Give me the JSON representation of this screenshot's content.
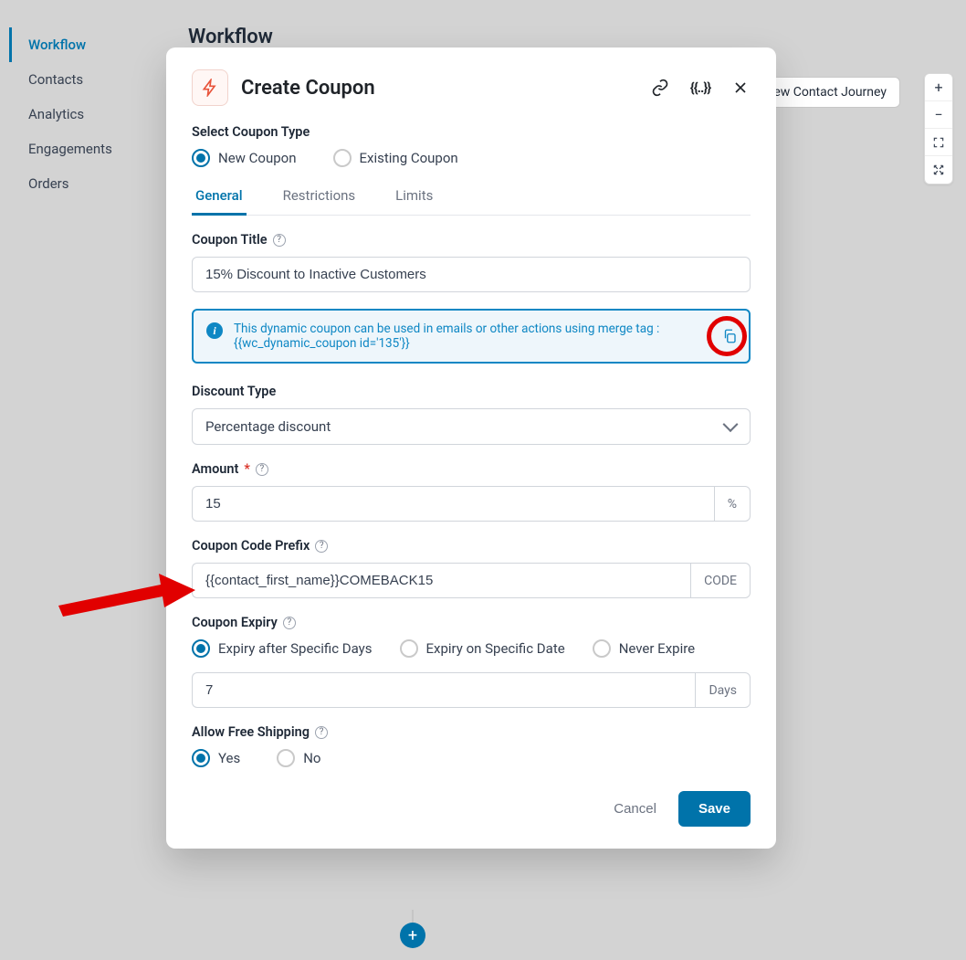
{
  "sidebar": {
    "items": [
      {
        "label": "Workflow",
        "active": true
      },
      {
        "label": "Contacts",
        "active": false
      },
      {
        "label": "Analytics",
        "active": false
      },
      {
        "label": "Engagements",
        "active": false
      },
      {
        "label": "Orders",
        "active": false
      }
    ]
  },
  "page": {
    "heading": "Workflow"
  },
  "peek_button": "ew Contact Journey",
  "zoom": {
    "plus": "+",
    "minus": "−"
  },
  "modal": {
    "title": "Create Coupon",
    "merge_icon": "{{..}}",
    "select_type_label": "Select Coupon Type",
    "type_options": {
      "new": "New Coupon",
      "existing": "Existing Coupon"
    },
    "tabs": {
      "general": "General",
      "restrictions": "Restrictions",
      "limits": "Limits"
    },
    "coupon_title_label": "Coupon Title",
    "coupon_title_value": "15% Discount to Inactive Customers",
    "info_banner": {
      "line1": "This dynamic coupon can be used in emails or other actions using merge tag :",
      "line2": "{{wc_dynamic_coupon id='135'}}"
    },
    "discount_type_label": "Discount Type",
    "discount_type_value": "Percentage discount",
    "amount_label": "Amount",
    "amount_value": "15",
    "amount_suffix": "%",
    "prefix_label": "Coupon Code Prefix",
    "prefix_value": "{{contact_first_name}}COMEBACK15",
    "prefix_suffix": "CODE",
    "expiry_label": "Coupon Expiry",
    "expiry_options": {
      "days": "Expiry after Specific Days",
      "date": "Expiry on Specific Date",
      "never": "Never Expire"
    },
    "expiry_value": "7",
    "expiry_suffix": "Days",
    "free_ship_label": "Allow Free Shipping",
    "yes": "Yes",
    "no": "No",
    "cancel": "Cancel",
    "save": "Save"
  },
  "help_glyph": "?",
  "info_glyph": "i",
  "plus_glyph": "+"
}
